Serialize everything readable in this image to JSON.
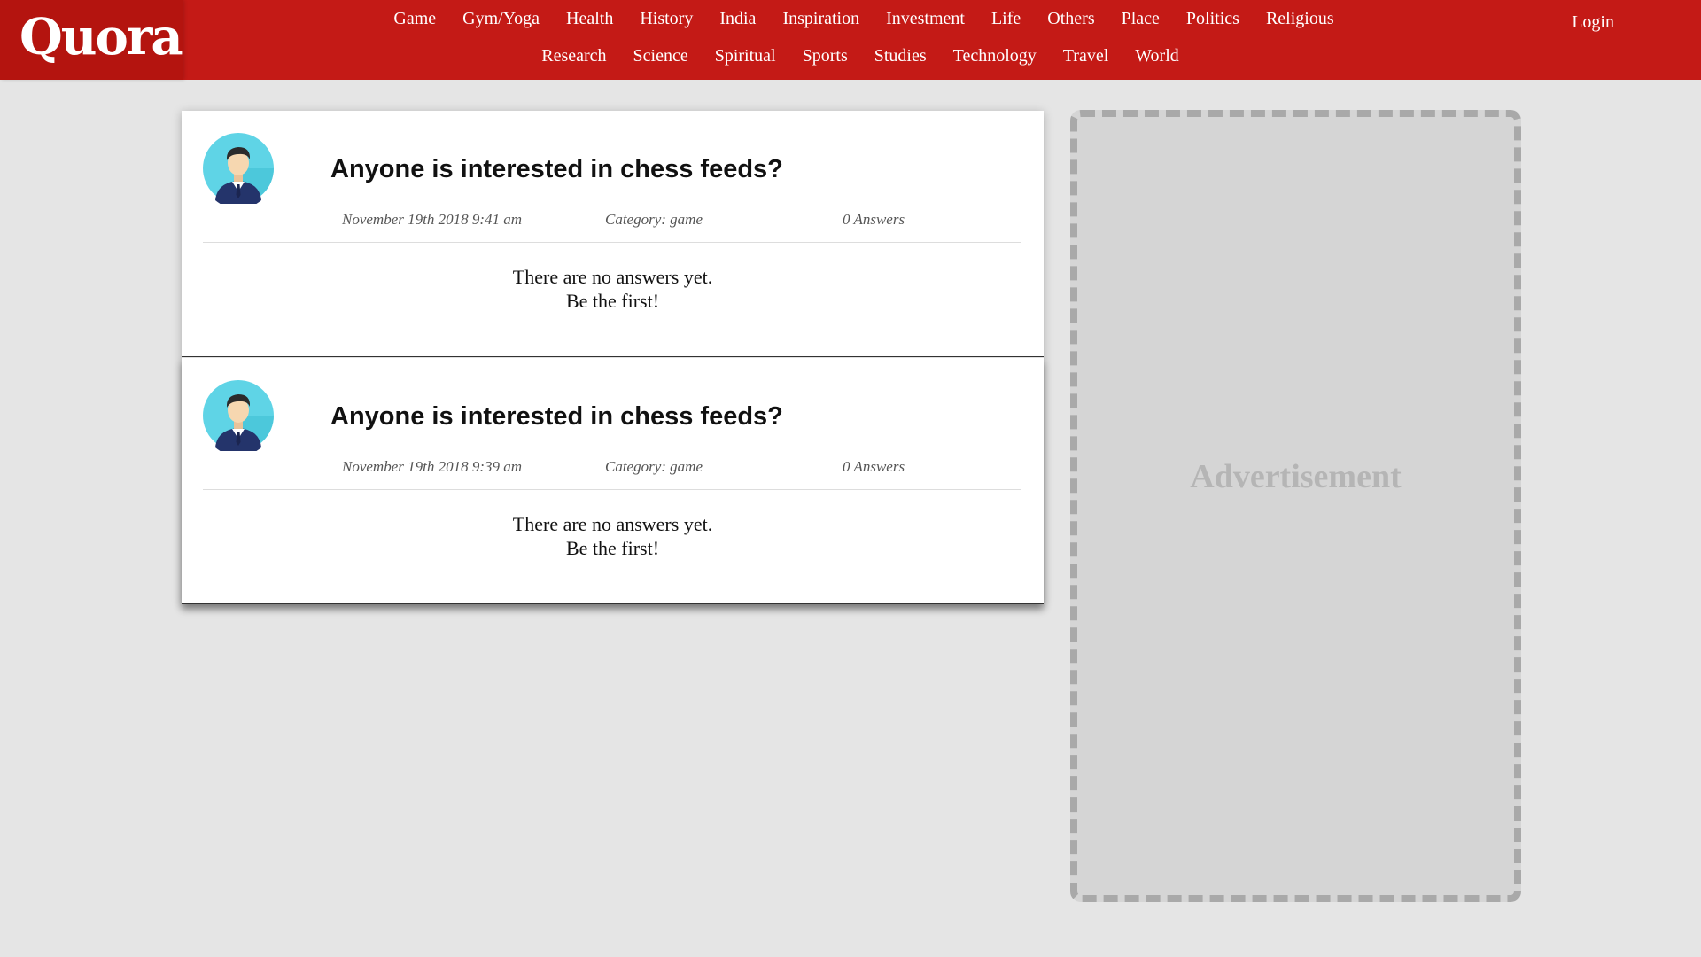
{
  "brand": {
    "logo_text": "Quora",
    "primary_color": "#c41a16"
  },
  "nav": {
    "row1": [
      "Game",
      "Gym/Yoga",
      "Health",
      "History",
      "India",
      "Inspiration",
      "Investment",
      "Life",
      "Others",
      "Place",
      "Politics",
      "Religious"
    ],
    "row2": [
      "Research",
      "Science",
      "Spiritual",
      "Sports",
      "Studies",
      "Technology",
      "Travel",
      "World"
    ],
    "login_label": "Login"
  },
  "questions": [
    {
      "title": "Anyone is interested in chess feeds?",
      "date": "November 19th 2018 9:41 am",
      "category": "Category: game",
      "answers": "0 Answers",
      "empty_line1": "There are no answers yet.",
      "empty_line2": "Be the first!",
      "avatar_icon": "user-avatar-icon"
    },
    {
      "title": "Anyone is interested in chess feeds?",
      "date": "November 19th 2018 9:39 am",
      "category": "Category: game",
      "answers": "0 Answers",
      "empty_line1": "There are no answers yet.",
      "empty_line2": "Be the first!",
      "avatar_icon": "user-avatar-icon"
    }
  ],
  "sidebar": {
    "ad_label": "Advertisement"
  }
}
